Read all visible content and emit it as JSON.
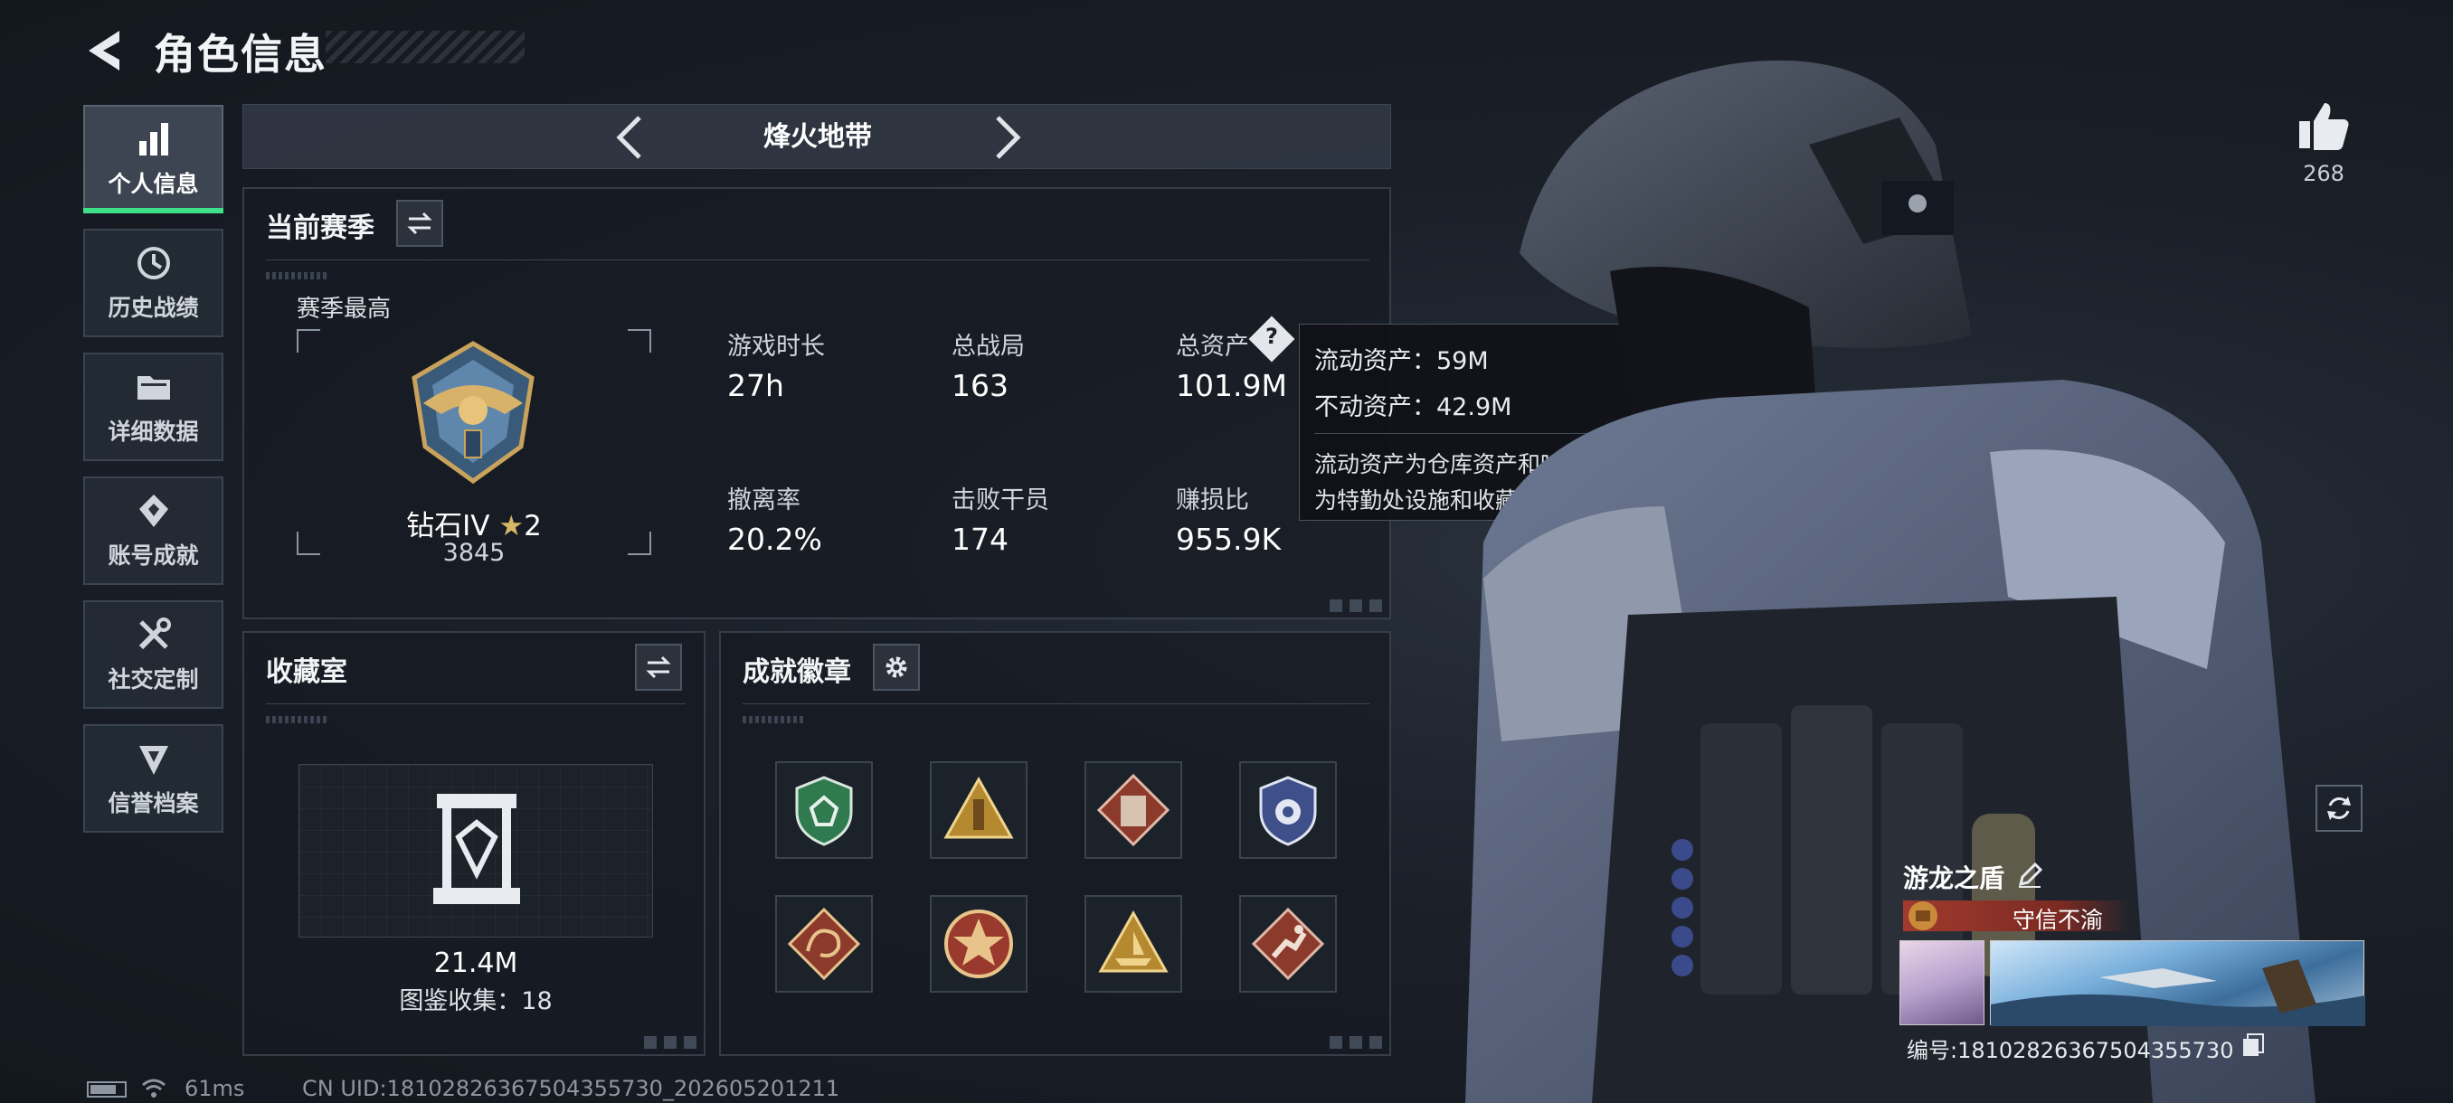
{
  "header": {
    "title": "角色信息"
  },
  "nav": {
    "items": [
      {
        "label": "个人信息",
        "icon": "bar-chart-icon",
        "active": true
      },
      {
        "label": "历史战绩",
        "icon": "history-icon"
      },
      {
        "label": "详细数据",
        "icon": "folder-icon"
      },
      {
        "label": "账号成就",
        "icon": "achievement-icon"
      },
      {
        "label": "社交定制",
        "icon": "tools-icon"
      },
      {
        "label": "信誉档案",
        "icon": "reputation-icon"
      }
    ]
  },
  "mode": {
    "title": "烽火地带"
  },
  "season": {
    "title": "当前赛季",
    "best_label": "赛季最高",
    "rank_name": "钻石IV",
    "rank_stars": "2",
    "rank_score": "3845",
    "stats": [
      {
        "label": "游戏时长",
        "value": "27h"
      },
      {
        "label": "总战局",
        "value": "163"
      },
      {
        "label": "总资产",
        "value": "101.9M"
      },
      {
        "label": "撤离率",
        "value": "20.2%"
      },
      {
        "label": "击败干员",
        "value": "174"
      },
      {
        "label": "赚损比",
        "value": "955.9K"
      }
    ]
  },
  "tooltip": {
    "liquid": "流动资产：59M",
    "fixed": "不动资产：42.9M",
    "desc_line1": "流动资产为仓库资产和哈夫币，不动资产",
    "desc_line2": "为特勤处设施和收藏室设施"
  },
  "collection": {
    "title": "收藏室",
    "value": "21.4M",
    "catalog": "图鉴收集：18"
  },
  "achievements": {
    "title": "成就徽章",
    "badges": [
      {
        "icon": "green-shield-badge-icon",
        "color": "#2f7a4f"
      },
      {
        "icon": "gold-triangle-badge-icon",
        "color": "#b4892f"
      },
      {
        "icon": "red-vest-badge-icon",
        "color": "#8c3a2c"
      },
      {
        "icon": "blue-shield-badge-icon",
        "color": "#3f4f8a"
      },
      {
        "icon": "dragon-badge-icon",
        "color": "#8c3a2c"
      },
      {
        "icon": "star-medal-badge-icon",
        "color": "#9a3a2e"
      },
      {
        "icon": "gold-ship-badge-icon",
        "color": "#b4892f"
      },
      {
        "icon": "runner-badge-icon",
        "color": "#8c3a2c"
      }
    ]
  },
  "profile": {
    "likes": "268",
    "name": "游龙之盾",
    "honor": "守信不渝",
    "id_text": "编号:1810282636750435573​0"
  },
  "status": {
    "ping": "61ms",
    "uid": "CN UID:1810282636750435573​0_202605201211"
  }
}
